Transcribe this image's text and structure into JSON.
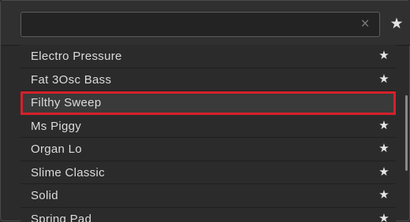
{
  "search": {
    "value": "",
    "placeholder": "",
    "clear_icon": "×",
    "favorites_icon": "★"
  },
  "items": [
    {
      "label": "Electro Pressure",
      "favorite": true,
      "selected": false
    },
    {
      "label": "Fat 3Osc Bass",
      "favorite": true,
      "selected": false
    },
    {
      "label": "Filthy Sweep",
      "favorite": false,
      "selected": true
    },
    {
      "label": "Ms Piggy",
      "favorite": true,
      "selected": false
    },
    {
      "label": "Organ Lo",
      "favorite": true,
      "selected": false
    },
    {
      "label": "Slime Classic",
      "favorite": true,
      "selected": false
    },
    {
      "label": "Solid",
      "favorite": true,
      "selected": false
    },
    {
      "label": "Spring Pad",
      "favorite": true,
      "selected": false
    }
  ],
  "star_glyph": "★",
  "colors": {
    "selection_outline": "#d4212b",
    "background": "#2b2b2b",
    "text": "#dcdcdc"
  }
}
